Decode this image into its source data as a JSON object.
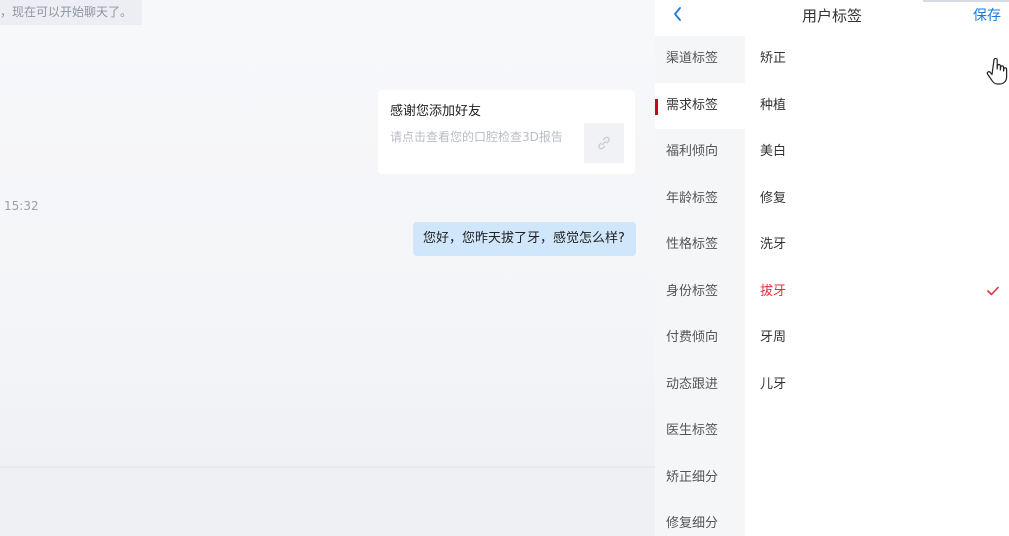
{
  "chat": {
    "system_notice": "，现在可以开始聊天了。",
    "card": {
      "title": "感谢您添加好友",
      "description": "请点击查看您的口腔检查3D报告",
      "icon": "link-icon"
    },
    "timestamp": "15:32",
    "message": "您好，您昨天拔了牙，感觉怎么样?"
  },
  "panel": {
    "title": "用户标签",
    "save_label": "保存",
    "back_icon": "chevron-left-icon",
    "categories": [
      {
        "label": "渠道标签"
      },
      {
        "label": "需求标签"
      },
      {
        "label": "福利倾向"
      },
      {
        "label": "年龄标签"
      },
      {
        "label": "性格标签"
      },
      {
        "label": "身份标签"
      },
      {
        "label": "付费倾向"
      },
      {
        "label": "动态跟进"
      },
      {
        "label": "医生标签"
      },
      {
        "label": "矫正细分"
      },
      {
        "label": "修复细分"
      }
    ],
    "active_category": "需求标签",
    "tags": [
      {
        "label": "矫正"
      },
      {
        "label": "种植"
      },
      {
        "label": "美白"
      },
      {
        "label": "修复"
      },
      {
        "label": "洗牙"
      },
      {
        "label": "拔牙"
      },
      {
        "label": "牙周"
      },
      {
        "label": "儿牙"
      }
    ],
    "selected_tag": "拔牙"
  },
  "colors": {
    "accent": "#1a7bdc",
    "active_marker": "#d0021b",
    "selected_tag": "#e0323c",
    "bubble": "#cfe6fb"
  }
}
